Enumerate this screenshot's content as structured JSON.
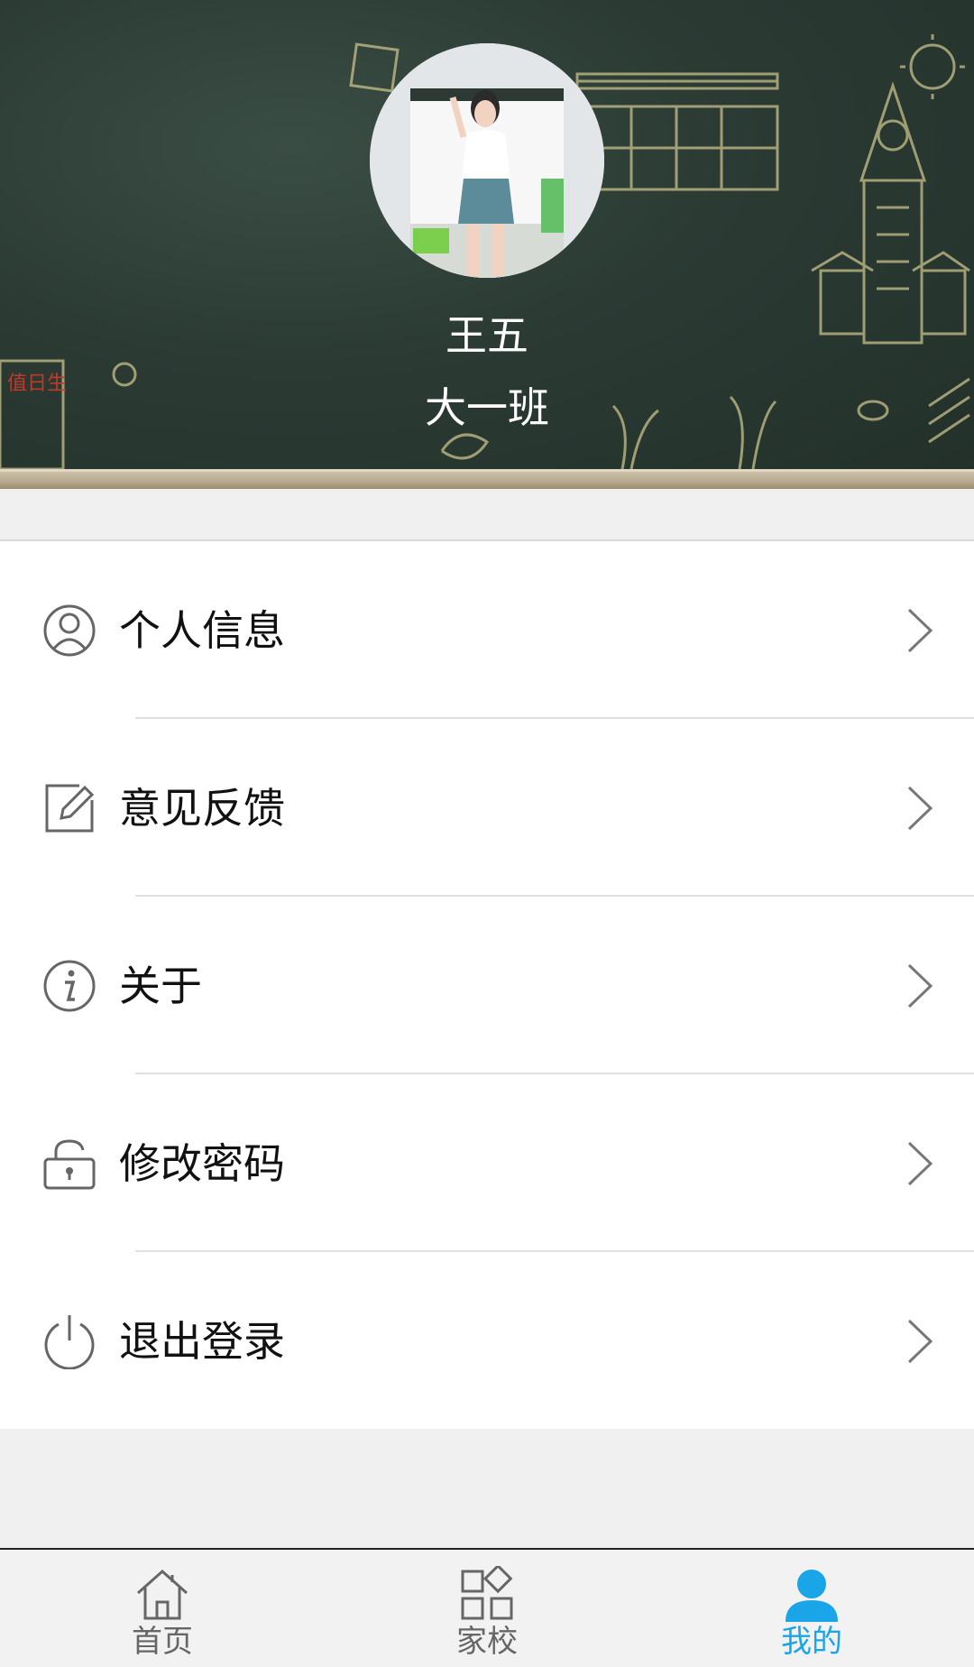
{
  "profile": {
    "name": "王五",
    "class_name": "大一班"
  },
  "menu": {
    "items": [
      {
        "label": "个人信息",
        "icon": "user-circle-icon"
      },
      {
        "label": "意见反馈",
        "icon": "edit-icon"
      },
      {
        "label": "关于",
        "icon": "info-icon"
      },
      {
        "label": "修改密码",
        "icon": "lock-icon"
      },
      {
        "label": "退出登录",
        "icon": "power-icon"
      }
    ]
  },
  "nav": {
    "items": [
      {
        "label": "首页",
        "icon": "home-icon"
      },
      {
        "label": "家校",
        "icon": "apps-icon"
      },
      {
        "label": "我的",
        "icon": "person-icon",
        "active": true
      }
    ],
    "active_color": "#1aa5e8",
    "inactive_color": "#666666"
  },
  "header": {
    "chalk_sign": "值日生"
  }
}
